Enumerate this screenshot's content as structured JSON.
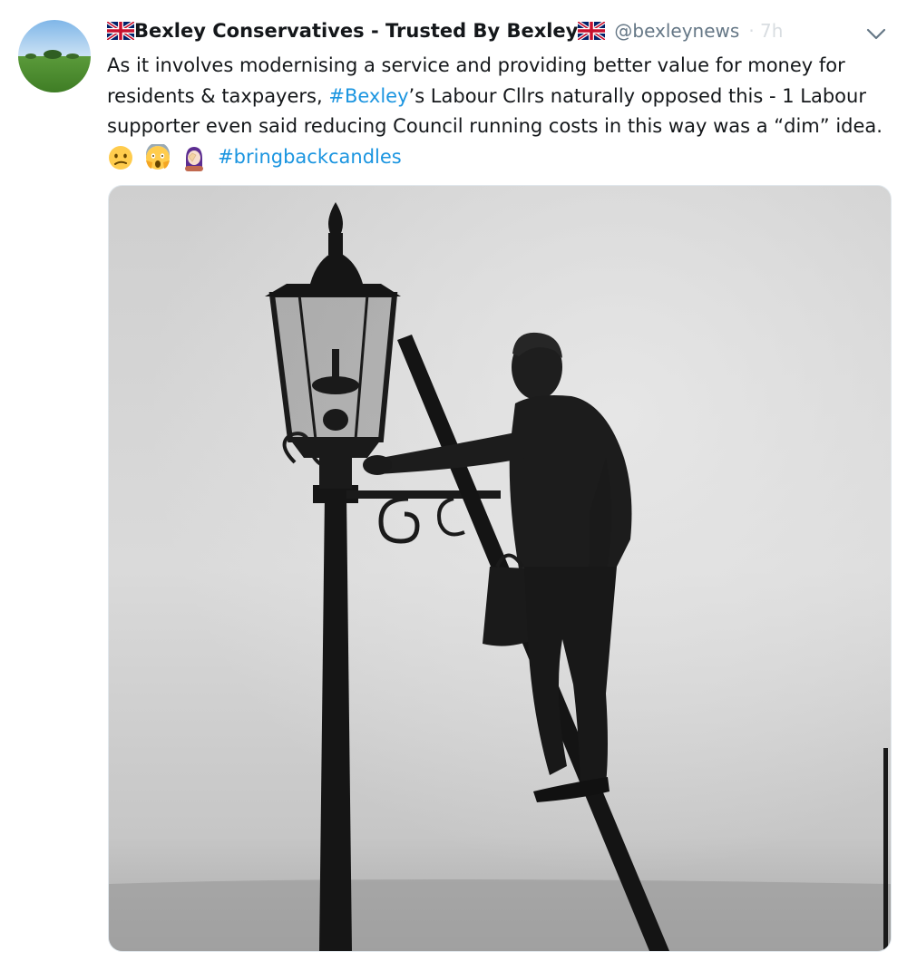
{
  "tweet": {
    "display_name": "Bexley Conservatives - Trusted By Bexley",
    "handle": "@bexleynews",
    "time": "· 7h",
    "text": {
      "line1": "As it involves modernising a service and providing better value for money for",
      "line2_a": "residents & taxpayers, ",
      "line2_hashtag": "#Bexley",
      "line2_b": "’s Labour Cllrs naturally opposed this - 1 Labour",
      "line3": "supporter even said reducing Council running costs in this way was a “dim” idea.",
      "hashtag2": "#bringbackcandles"
    },
    "emojis": [
      "confused-face-emoji",
      "screaming-face-emoji",
      "woman-facepalming-emoji"
    ],
    "media": {
      "description_icon": "lamplighter-photo"
    }
  },
  "colors": {
    "link": "#1b95e0",
    "text": "#14171a",
    "handle": "#657786",
    "border": "#e1e8ed"
  }
}
